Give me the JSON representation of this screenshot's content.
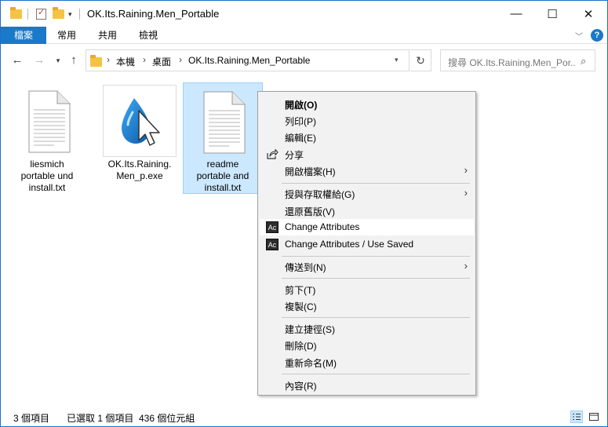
{
  "window": {
    "title": "OK.Its.Raining.Men_Portable"
  },
  "ribbon": {
    "tabs": [
      "檔案",
      "常用",
      "共用",
      "檢視"
    ],
    "help": "?"
  },
  "nav": {
    "breadcrumb": [
      "本機",
      "桌面",
      "OK.Its.Raining.Men_Portable"
    ],
    "search_placeholder": "搜尋 OK.Its.Raining.Men_Por..."
  },
  "files": [
    {
      "name_lines": [
        "liesmich",
        "portable und",
        "install.txt"
      ],
      "icon": "text-document-icon",
      "selected": false
    },
    {
      "name_lines": [
        "OK.Its.Raining.",
        "Men_p.exe"
      ],
      "icon": "water-drop-cursor-icon",
      "selected": false
    },
    {
      "name_lines": [
        "readme",
        "portable and",
        "install.txt"
      ],
      "icon": "text-document-icon",
      "selected": true
    }
  ],
  "context_menu": {
    "items": [
      {
        "label": "開啟(O)",
        "bold": true
      },
      {
        "label": "列印(P)"
      },
      {
        "label": "編輯(E)"
      },
      {
        "label": "分享",
        "icon": "share-icon"
      },
      {
        "label": "開啟檔案(H)",
        "submenu": true
      },
      {
        "label": "授與存取權給(G)",
        "submenu": true
      },
      {
        "label": "還原舊版(V)"
      },
      {
        "label": "Change Attributes",
        "icon": "ac-icon",
        "highlighted": true
      },
      {
        "label": "Change Attributes / Use Saved",
        "icon": "ac-icon"
      },
      {
        "label": "傳送到(N)",
        "submenu": true
      },
      {
        "label": "剪下(T)"
      },
      {
        "label": "複製(C)"
      },
      {
        "label": "建立捷徑(S)"
      },
      {
        "label": "刪除(D)"
      },
      {
        "label": "重新命名(M)"
      },
      {
        "label": "內容(R)"
      }
    ],
    "icon_text": "Ac"
  },
  "status": {
    "item_count": "3 個項目",
    "selection": "已選取 1 個項目  436 個位元組"
  },
  "colors": {
    "accent": "#1979ca",
    "selection_bg": "#cce8ff",
    "selection_border": "#99d1ff",
    "menu_bg": "#f2f2f2"
  }
}
